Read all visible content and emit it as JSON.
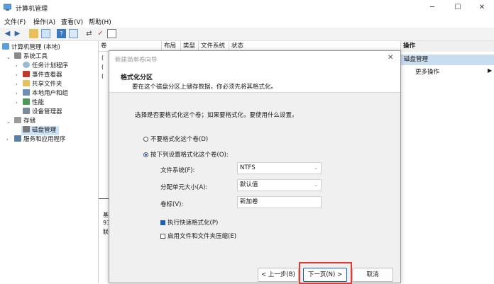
{
  "window": {
    "title": "计算机管理",
    "minimize_glyph": "─",
    "maximize_glyph": "☐",
    "close_glyph": "✕"
  },
  "menu": [
    "文件(F)",
    "操作(A)",
    "查看(V)",
    "帮助(H)"
  ],
  "tree": {
    "root": "计算机管理 (本地)",
    "system_tools": "系统工具",
    "task_scheduler": "任务计划程序",
    "event_viewer": "事件查看器",
    "shared_folders": "共享文件夹",
    "local_users": "本地用户和组",
    "performance": "性能",
    "device_manager": "设备管理器",
    "storage": "存储",
    "disk_management": "磁盘管理",
    "services": "服务和应用程序"
  },
  "columns": [
    "卷",
    "布局",
    "类型",
    "文件系统",
    "状态"
  ],
  "left_stub": [
    "(",
    "(",
    "(",
    "基",
    "93",
    "联"
  ],
  "actions": {
    "header": "操作",
    "section": "磁盘管理",
    "more": "更多操作"
  },
  "wizard": {
    "title": "新建简单卷向导",
    "heading": "格式化分区",
    "subheading": "要在这个磁盘分区上储存数据，你必须先将其格式化。",
    "prompt": "选择是否要格式化这个卷；如果要格式化，要使用什么设置。",
    "opt_no_format": "不要格式化这个卷(D)",
    "opt_format": "按下列设置格式化这个卷(O):",
    "fs_label": "文件系统(F):",
    "fs_value": "NTFS",
    "alloc_label": "分配单元大小(A):",
    "alloc_value": "默认值",
    "vol_label": "卷标(V):",
    "vol_value": "新加卷",
    "quick_format": "执行快速格式化(P)",
    "compression": "启用文件和文件夹压缩(E)",
    "back": "< 上一步(B)",
    "next": "下一页(N) >",
    "cancel": "取消"
  },
  "colors": {
    "accent": "#1a5fb4",
    "selection": "#cce4f7",
    "highlight_box": "#e53935"
  }
}
